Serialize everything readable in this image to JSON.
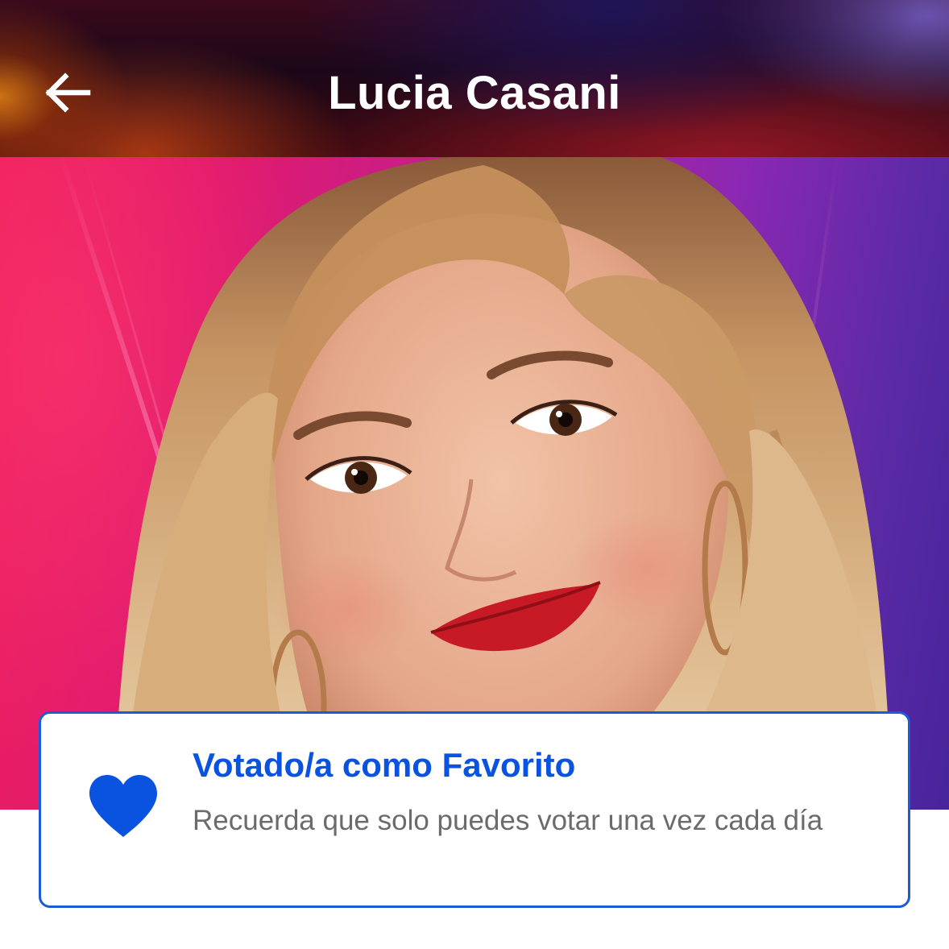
{
  "header": {
    "title": "Lucia Casani",
    "back_icon": "arrow-left-icon"
  },
  "hero": {
    "image": "contestant-portrait"
  },
  "vote_card": {
    "icon": "heart-icon",
    "title": "Votado/a como Favorito",
    "message": "Recuerda que solo puedes votar una vez cada día"
  },
  "colors": {
    "accent_blue": "#0a52e0",
    "card_border": "#1b5bd6",
    "message_gray": "#6b6b6b",
    "title_white": "#ffffff"
  }
}
